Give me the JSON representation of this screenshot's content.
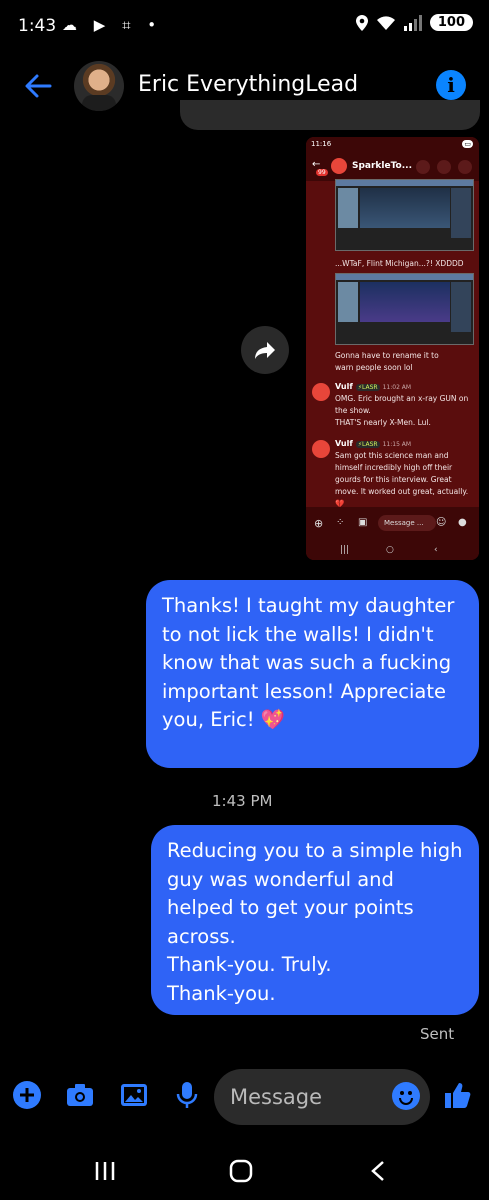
{
  "status_bar": {
    "time": "1:43",
    "left_icons": "☁ ▶ ⌗ •",
    "battery": "100"
  },
  "header": {
    "contact_name": "Eric EverythingLead"
  },
  "shared_screenshot": {
    "status_time": "11:16",
    "channel_name": "SparkleTo...",
    "badge": "99",
    "caption_1": "...WTaF, Flint Michigan...?! XDDDD",
    "caption_2": "Gonna have to rename it to warn people soon lol",
    "msg1_user": "Vulf",
    "msg1_tag": "⚡LASR",
    "msg1_time": "11:02 AM",
    "msg1_text": "OMG. Eric brought an x-ray GUN on the show.",
    "msg1_text2": "THAT'S nearly X-Men. Lul.",
    "msg2_user": "Vulf",
    "msg2_tag": "⚡LASR",
    "msg2_time": "11:15 AM",
    "msg2_text": "Sam got this science man and himself incredibly high off their gourds for this interview. Great move. It worked out great, actually. 💔",
    "input_placeholder": "Message ..."
  },
  "messages": [
    {
      "text": "Thanks! I taught my daughter to not lick the walls! I didn't know that was such a fucking important lesson! Appreciate you, Eric! 💖"
    },
    {
      "text": "Reducing you to a simple high guy was wonderful and helped to get your points across.\nThank-you. Truly.\nThank-you."
    }
  ],
  "timestamp": "1:43 PM",
  "sent_label": "Sent",
  "composer": {
    "placeholder": "Message"
  },
  "colors": {
    "accent": "#2f63f6",
    "icon_blue": "#2f7bff",
    "background": "#000000"
  }
}
